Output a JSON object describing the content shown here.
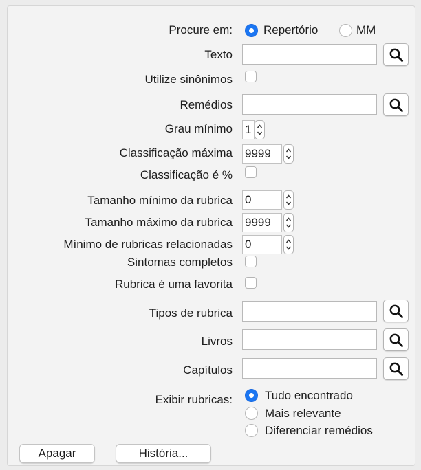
{
  "search_in": {
    "label": "Procure em:",
    "options": [
      {
        "label": "Repertório",
        "selected": true
      },
      {
        "label": "MM",
        "selected": false
      }
    ]
  },
  "text": {
    "label": "Texto",
    "value": ""
  },
  "use_synonyms": {
    "label": "Utilize sinônimos",
    "checked": false
  },
  "remedies": {
    "label": "Remédios",
    "value": ""
  },
  "min_degree": {
    "label": "Grau mínimo",
    "value": "1"
  },
  "max_rank": {
    "label": "Classificação máxima",
    "value": "9999"
  },
  "rank_percent": {
    "label": "Classificação é %",
    "checked": false
  },
  "min_rubric_size": {
    "label": "Tamanho mínimo da rubrica",
    "value": "0"
  },
  "max_rubric_size": {
    "label": "Tamanho máximo da rubrica",
    "value": "9999"
  },
  "min_related_rubrics": {
    "label": "Mínimo de rubricas relacionadas",
    "value": "0"
  },
  "complete_symptoms": {
    "label": "Sintomas completos",
    "checked": false
  },
  "favorite_rubric": {
    "label": "Rubrica é uma favorita",
    "checked": false
  },
  "rubric_types": {
    "label": "Tipos de rubrica",
    "value": ""
  },
  "books": {
    "label": "Livros",
    "value": ""
  },
  "chapters": {
    "label": "Capítulos",
    "value": ""
  },
  "show_rubrics": {
    "label": "Exibir rubricas:",
    "options": [
      {
        "label": "Tudo encontrado",
        "selected": true
      },
      {
        "label": "Mais relevante",
        "selected": false
      },
      {
        "label": "Diferenciar remédios",
        "selected": false
      }
    ]
  },
  "buttons": {
    "clear": "Apagar",
    "history": "História..."
  },
  "icons": {
    "search": "magnifier-icon",
    "stepper_up": "chevron-up-icon",
    "stepper_down": "chevron-down-icon"
  },
  "colors": {
    "accent": "#1b76f2",
    "background": "#ececec"
  }
}
